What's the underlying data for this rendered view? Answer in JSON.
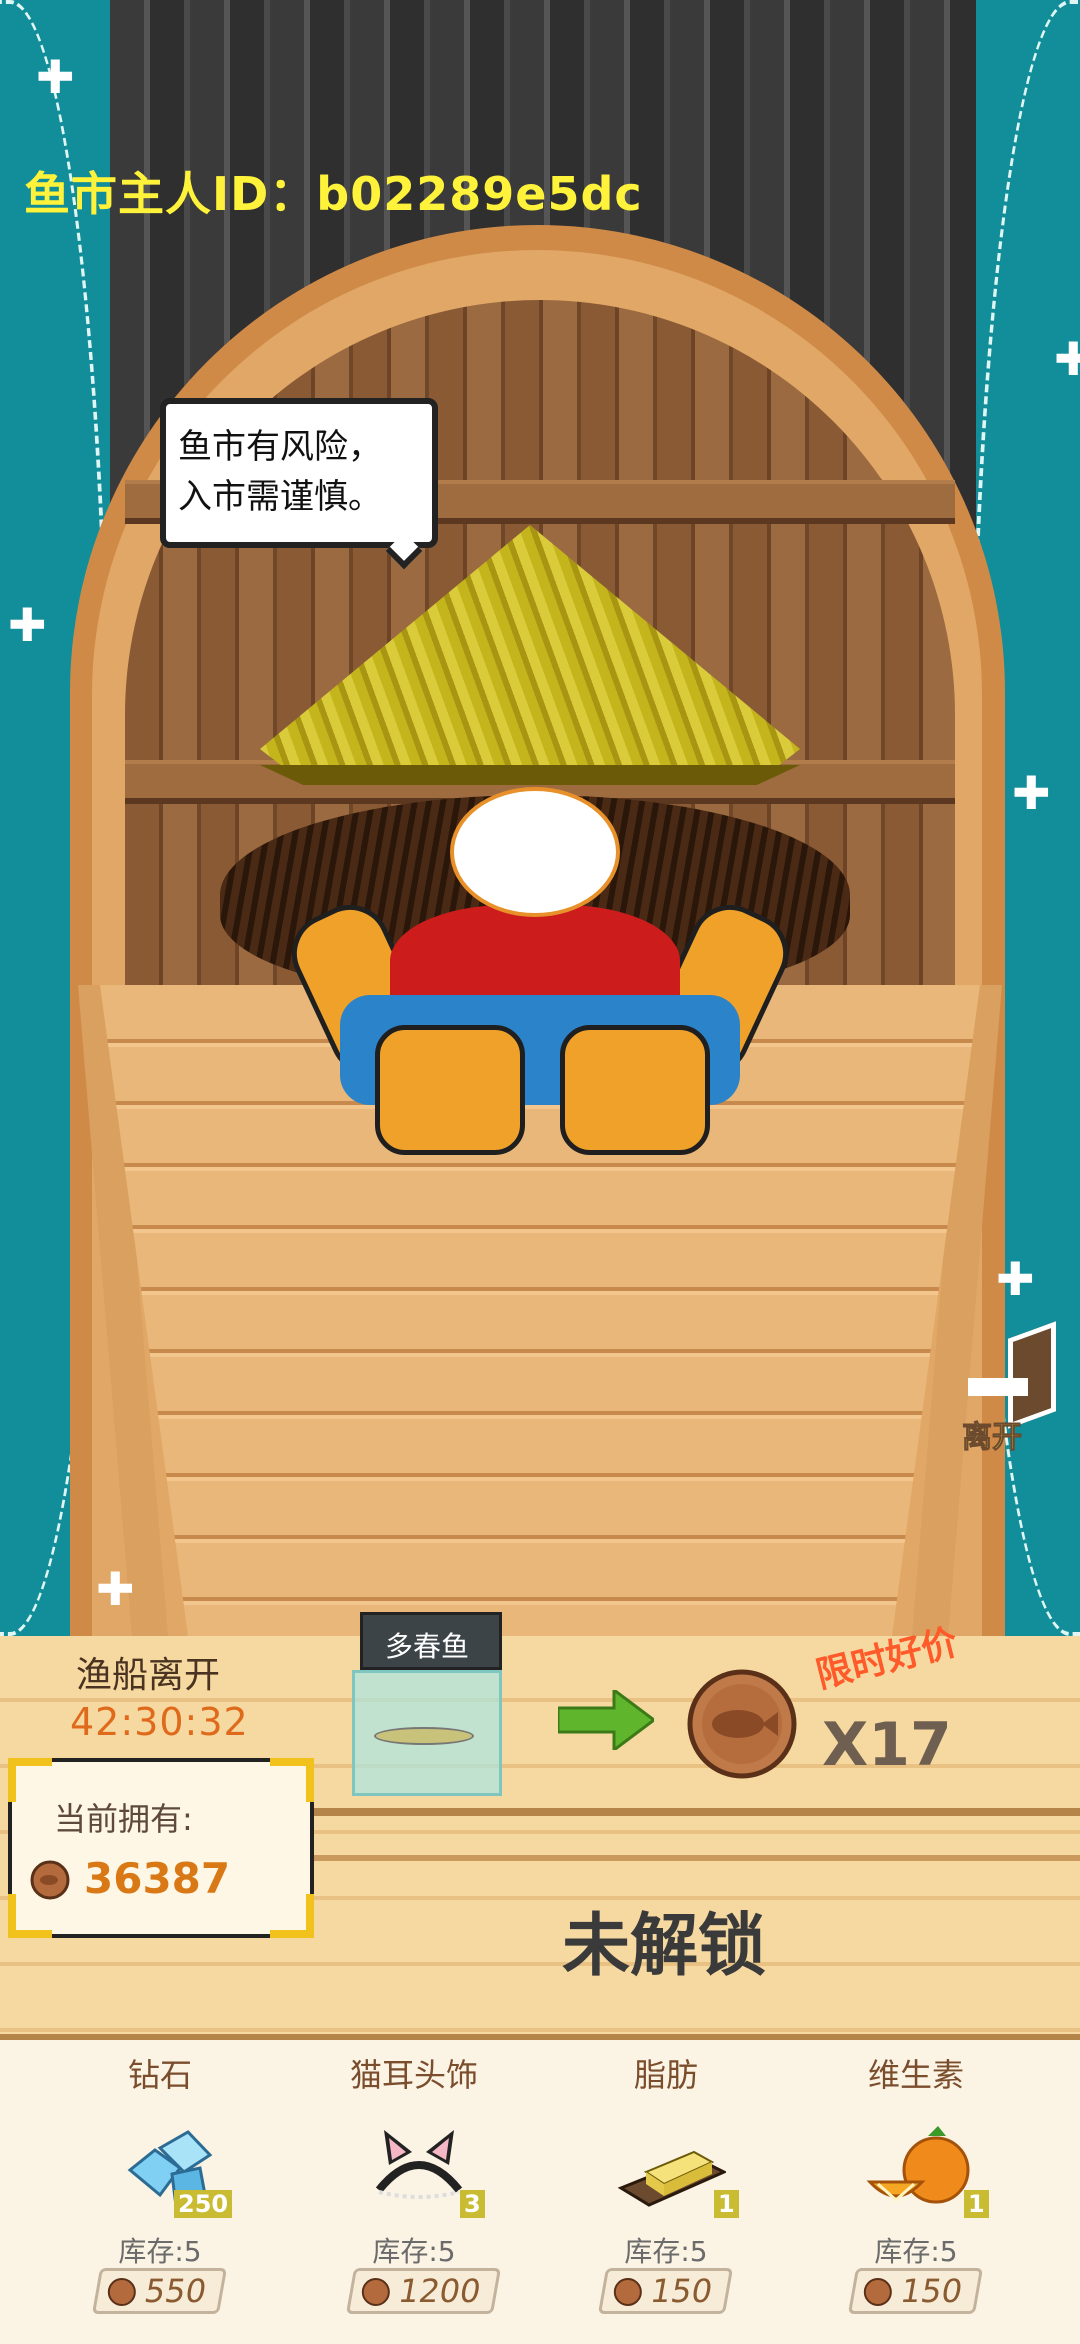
{
  "owner": {
    "label": "鱼市主人ID：b02289e5dc"
  },
  "speech_bubble": {
    "line1": "鱼市有风险，",
    "line2": "入市需谨慎。"
  },
  "leave_button": {
    "label": "离开"
  },
  "boat": {
    "departure_label": "渔船离开",
    "departure_timer": "42:30:32"
  },
  "wallet": {
    "label": "当前拥有:",
    "amount": "36387"
  },
  "offer": {
    "fish_name": "多春鱼",
    "promo_label": "限时好价",
    "price": "X17"
  },
  "locked_text": "未解锁",
  "items": [
    {
      "name": "钻石",
      "badge": "250",
      "stock": "库存:5",
      "price": "550",
      "icon": "diamond-icon"
    },
    {
      "name": "猫耳头饰",
      "badge": "3",
      "stock": "库存:5",
      "price": "1200",
      "icon": "cat-ear-headband-icon"
    },
    {
      "name": "脂肪",
      "badge": "1",
      "stock": "库存:5",
      "price": "150",
      "icon": "fat-icon"
    },
    {
      "name": "维生素",
      "badge": "1",
      "stock": "库存:5",
      "price": "150",
      "icon": "vitamin-icon"
    }
  ],
  "colors": {
    "sea": "#118e99",
    "owner_id": "#fff23a",
    "timer": "#e06a1c",
    "coin_amount": "#d97916",
    "promo": "#ff5a2a"
  }
}
